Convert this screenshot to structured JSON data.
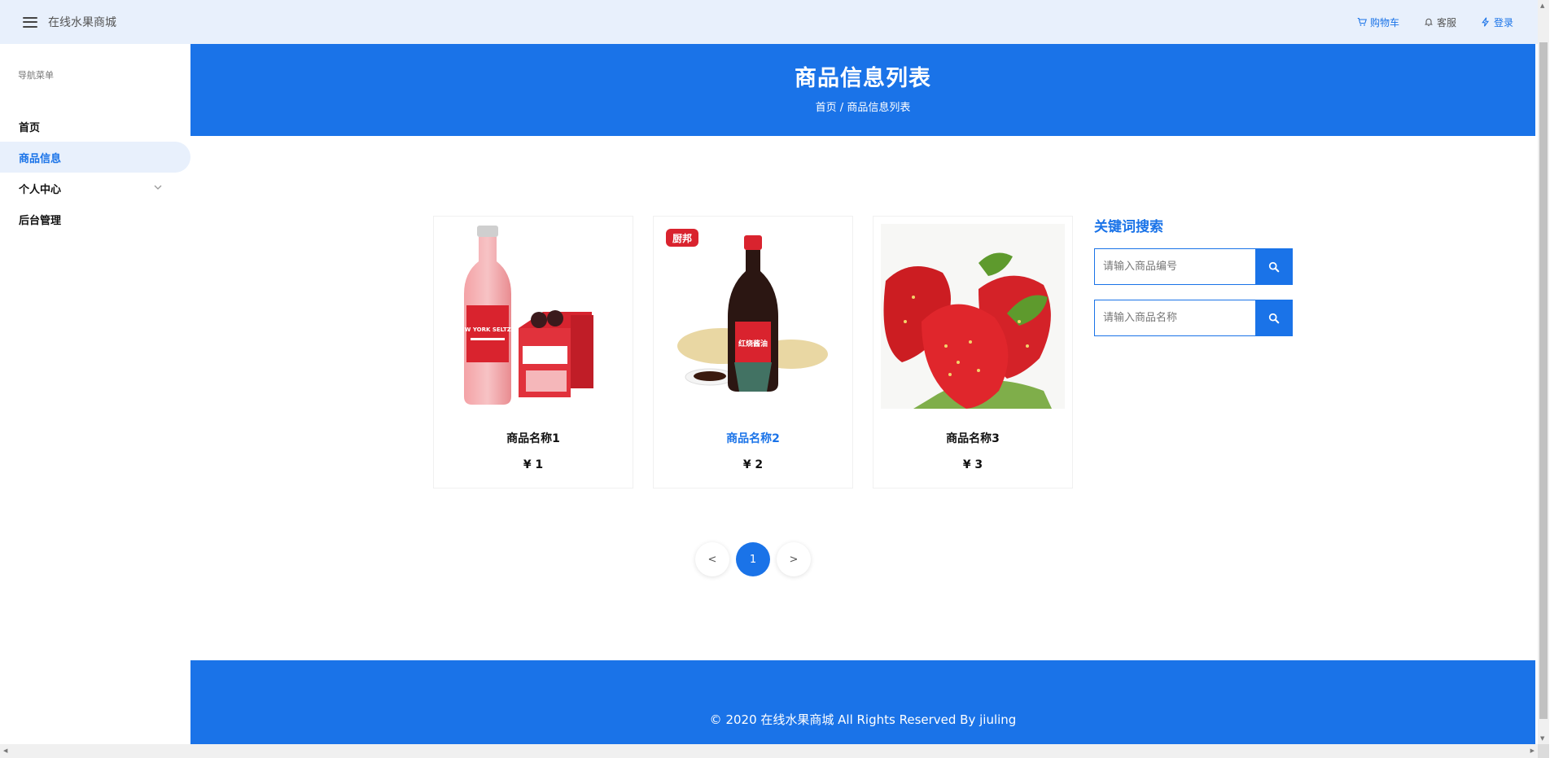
{
  "topbar": {
    "site_title": "在线水果商城",
    "links": [
      {
        "label": "购物车",
        "icon": "cart-icon"
      },
      {
        "label": "客服",
        "icon": "bell-icon"
      },
      {
        "label": "登录",
        "icon": "lightning-icon"
      }
    ]
  },
  "sidebar": {
    "heading": "导航菜单",
    "items": [
      {
        "label": "首页",
        "active": false
      },
      {
        "label": "商品信息",
        "active": true
      },
      {
        "label": "个人中心",
        "active": false,
        "has_submenu": true
      },
      {
        "label": "后台管理",
        "active": false
      }
    ]
  },
  "banner": {
    "title": "商品信息列表",
    "breadcrumb_home": "首页",
    "breadcrumb_sep": " / ",
    "breadcrumb_current": "商品信息列表"
  },
  "products": [
    {
      "name": "商品名称1",
      "price": "¥ 1",
      "image": "soda-bottle-image",
      "highlight": false
    },
    {
      "name": "商品名称2",
      "price": "¥ 2",
      "image": "soy-sauce-bottle-image",
      "highlight": true
    },
    {
      "name": "商品名称3",
      "price": "¥ 3",
      "image": "strawberries-image",
      "highlight": false
    }
  ],
  "product_image_text": {
    "soda_label": "NEW YORK SELTZER",
    "sauce_brand": "厨邦",
    "sauce_label": "红烧酱油"
  },
  "search": {
    "title": "关键词搜索",
    "code_placeholder": "请输入商品编号",
    "name_placeholder": "请输入商品名称"
  },
  "pagination": {
    "prev": "<",
    "current": "1",
    "next": ">"
  },
  "footer": {
    "text": "© 2020 在线水果商城 All Rights Reserved By jiuling"
  },
  "colors": {
    "accent": "#1a73e8",
    "topbar_bg": "#e8f0fc"
  }
}
